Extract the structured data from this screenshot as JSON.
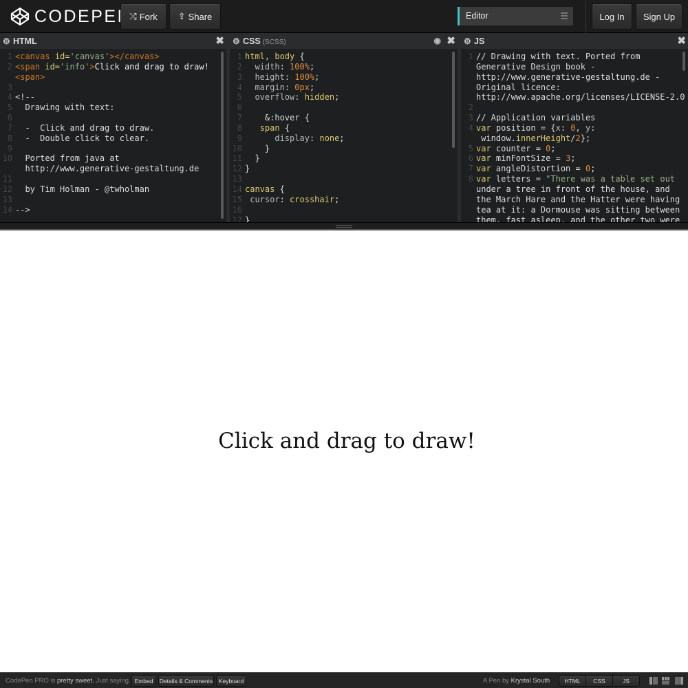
{
  "header": {
    "logo_text": "CODEPEN",
    "fork_label": "Fork",
    "share_label": "Share",
    "view_select": "Editor",
    "login_label": "Log In",
    "signup_label": "Sign Up",
    "accent_color": "#41c3c9"
  },
  "panes": {
    "html": {
      "title": "HTML",
      "icon": "gear-icon"
    },
    "css": {
      "title": "CSS",
      "sub": "(SCSS)",
      "icon": "gear-icon"
    },
    "js": {
      "title": "JS",
      "icon": "gear-icon"
    }
  },
  "result": {
    "info_text": "Click and drag to draw!"
  },
  "footer": {
    "promo_pre": "CodePen PRO is",
    "promo_bold": "pretty sweet.",
    "promo_post": "Just saying.",
    "embed_label": "Embed",
    "details_label": "Details & Comments",
    "keyboard_label": "Keyboard",
    "byline_pre": "A Pen by",
    "byline_author": "Krystal South",
    "tabs": [
      "HTML",
      "CSS",
      "JS"
    ]
  }
}
